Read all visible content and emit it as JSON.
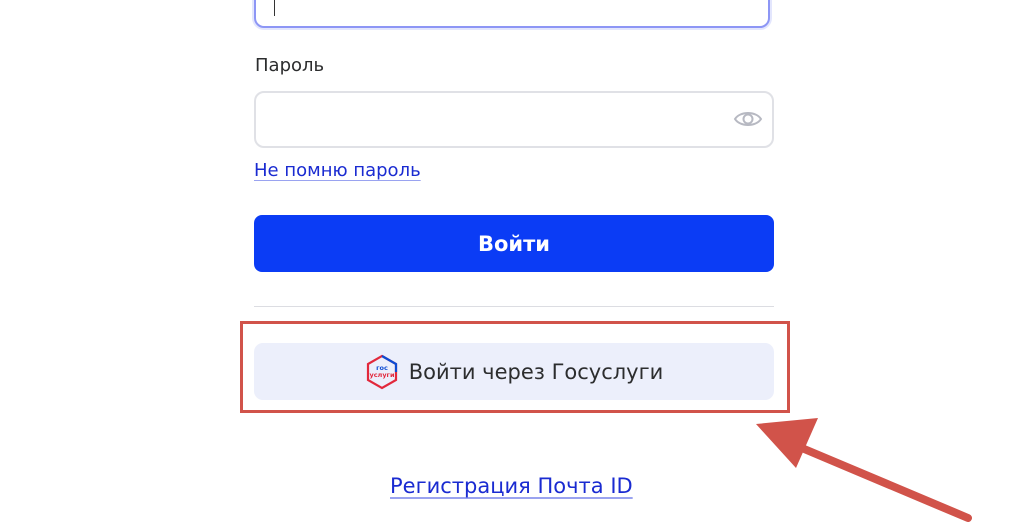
{
  "form": {
    "login_value": "",
    "password_label": "Пароль",
    "password_value": "",
    "forgot_password": "Не помню пароль",
    "login_button": "Войти",
    "gosuslugi_button": "Войти через Госуслуги",
    "gosuslugi_logo_text": [
      "гос",
      "услуги"
    ],
    "register_link": "Регистрация Почта ID"
  },
  "icons": {
    "password_toggle": "eye-icon",
    "gosuslugi": "gosuslugi-logo-icon"
  },
  "colors": {
    "primary": "#0b3cf5",
    "link": "#1a2bd1",
    "secondary_button_bg": "#eceffb",
    "annotation": "#d1534a"
  }
}
